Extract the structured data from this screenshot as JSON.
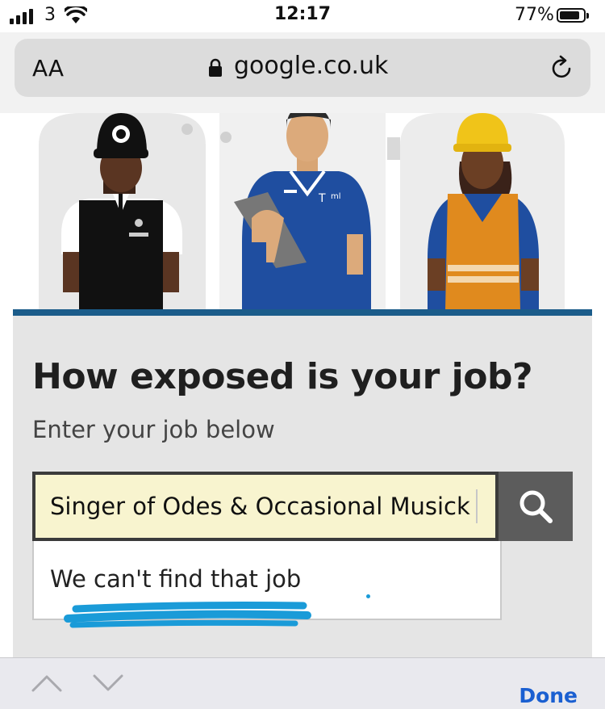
{
  "status_bar": {
    "carrier": "3",
    "time": "12:17",
    "battery": "77%",
    "battery_level": 0.77
  },
  "browser": {
    "text_size_label": "AA",
    "url": "google.co.uk",
    "lock_icon": "lock-icon",
    "reload_icon": "reload-icon"
  },
  "page": {
    "heading": "How exposed is your job?",
    "subheading": "Enter your job below",
    "search": {
      "value": "Singer of Odes & Occasional Musick",
      "button_icon": "search-icon"
    },
    "dropdown_message": "We can't find that job"
  },
  "toolbar": {
    "prev_icon": "chevron-up-icon",
    "next_icon": "chevron-down-icon",
    "done_label": "Done"
  },
  "colors": {
    "accent_stripe": "#1b5c8a",
    "input_background": "#f8f4cf",
    "scribble": "#1a9bd8",
    "done_link": "#1a5fd1"
  }
}
